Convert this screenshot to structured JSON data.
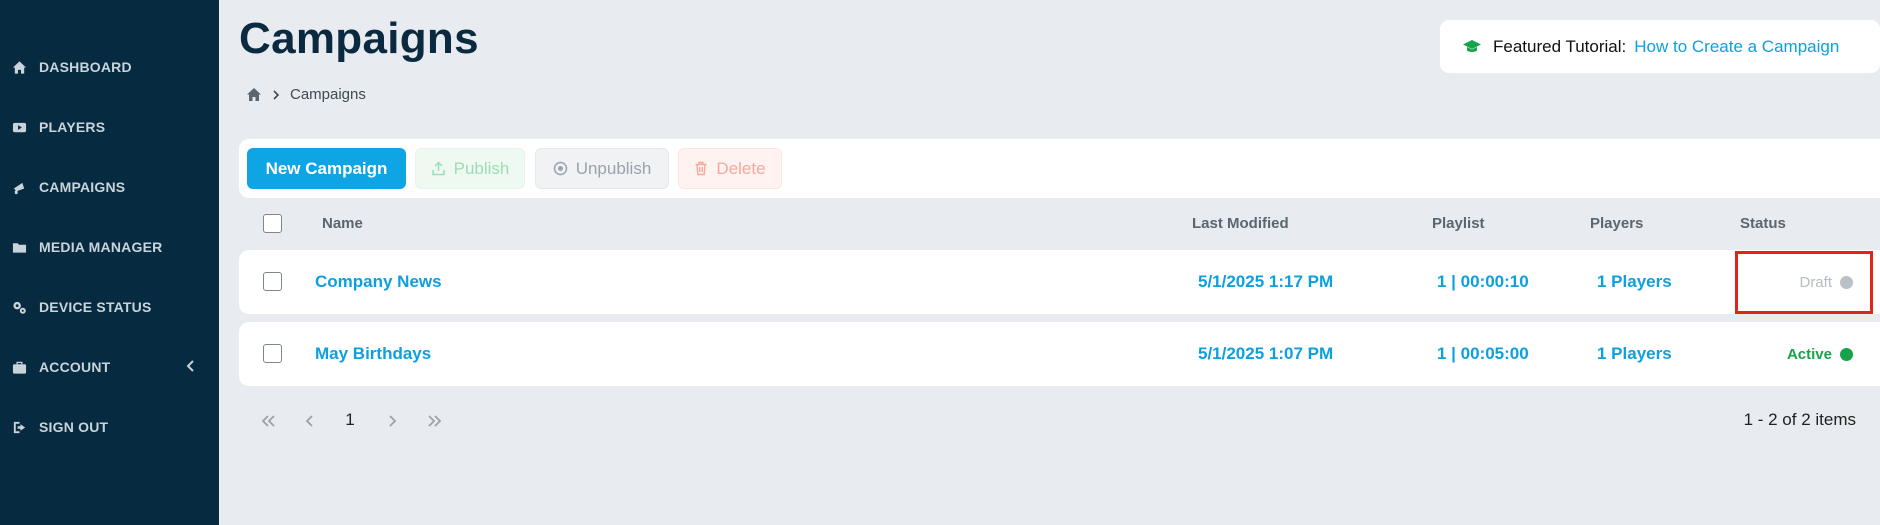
{
  "sidebar": {
    "items": [
      {
        "label": "DASHBOARD",
        "icon": "home-icon"
      },
      {
        "label": "PLAYERS",
        "icon": "play-icon"
      },
      {
        "label": "CAMPAIGNS",
        "icon": "megaphone-icon"
      },
      {
        "label": "MEDIA MANAGER",
        "icon": "folder-icon"
      },
      {
        "label": "DEVICE STATUS",
        "icon": "cogs-icon"
      },
      {
        "label": "ACCOUNT",
        "icon": "briefcase-icon"
      },
      {
        "label": "SIGN OUT",
        "icon": "sign-out-icon"
      }
    ]
  },
  "header": {
    "title": "Campaigns",
    "breadcrumb_current": "Campaigns",
    "tutorial_label": "Featured Tutorial:",
    "tutorial_link": "How to Create a Campaign"
  },
  "toolbar": {
    "new_label": "New Campaign",
    "publish_label": "Publish",
    "unpublish_label": "Unpublish",
    "delete_label": "Delete"
  },
  "table": {
    "columns": [
      "Name",
      "Last Modified",
      "Playlist",
      "Players",
      "Status"
    ],
    "rows": [
      {
        "name": "Company News",
        "modified": "5/1/2025 1:17 PM",
        "playlist": "1 | 00:00:10",
        "players": "1 Players",
        "status": "Draft"
      },
      {
        "name": "May Birthdays",
        "modified": "5/1/2025 1:07 PM",
        "playlist": "1 | 00:05:00",
        "players": "1 Players",
        "status": "Active"
      }
    ]
  },
  "pager": {
    "page": "1",
    "summary": "1 - 2 of 2 items"
  },
  "colors": {
    "sidebar_bg": "#062a40",
    "accent": "#0ea5e4",
    "draft": "#b5bcc3",
    "active": "#16a34a",
    "highlight": "#e2231a"
  }
}
